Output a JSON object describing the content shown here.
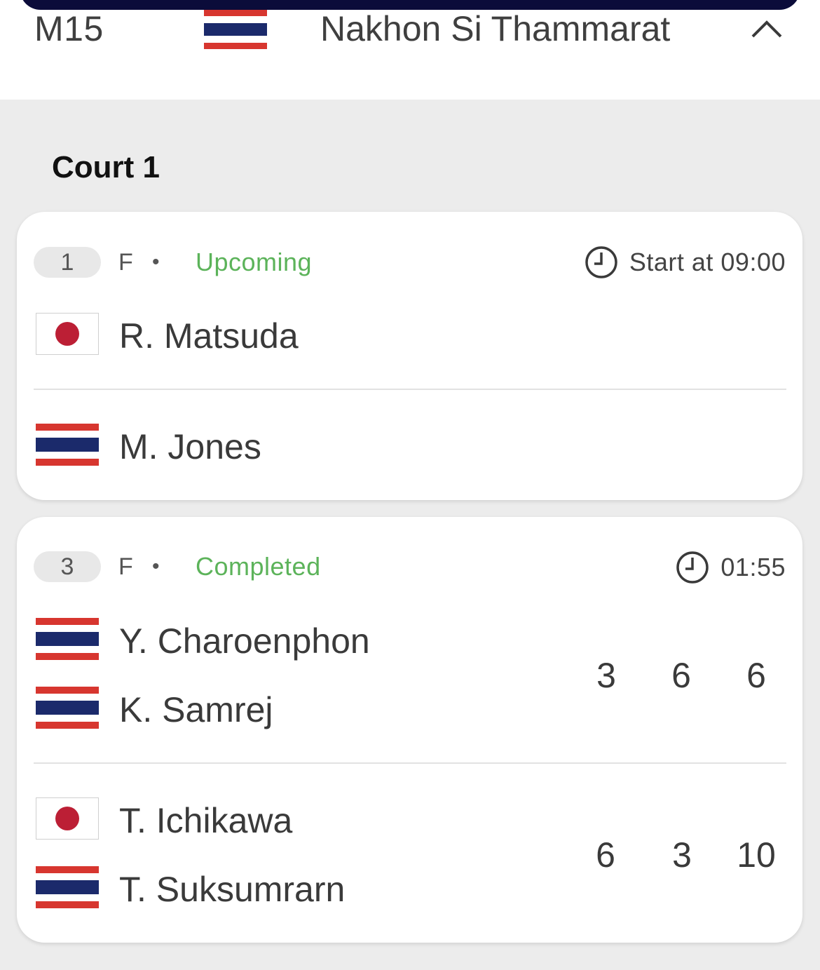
{
  "header": {
    "tour_code": "M15",
    "tour_name": "Nakhon Si Thammarat",
    "country_flag": "thailand-flag",
    "chevron": "chevron-up-icon"
  },
  "court": {
    "title": "Court 1"
  },
  "matches": [
    {
      "number": "1",
      "round": "F",
      "separator": "•",
      "status": "Upcoming",
      "time": "Start at 09:00",
      "players": [
        {
          "name": "R. Matsuda",
          "flag": "japan-flag"
        },
        {
          "name": "M. Jones",
          "flag": "thailand-flag"
        }
      ]
    },
    {
      "number": "3",
      "round": "F",
      "separator": "•",
      "status": "Completed",
      "time": "01:55",
      "teams": [
        {
          "players": [
            {
              "name": "Y. Charoenphon",
              "flag": "thailand-flag"
            },
            {
              "name": "K. Samrej",
              "flag": "thailand-flag"
            }
          ],
          "scores": [
            "3",
            "6",
            "6"
          ]
        },
        {
          "players": [
            {
              "name": "T. Ichikawa",
              "flag": "japan-flag"
            },
            {
              "name": "T. Suksumrarn",
              "flag": "thailand-flag"
            }
          ],
          "scores": [
            "6",
            "3",
            "10"
          ]
        }
      ]
    }
  ],
  "colors": {
    "status_green": "#5cb35a",
    "thai_red": "#d7362f",
    "thai_blue": "#1b2a6b",
    "japan_red": "#bc1f35",
    "header_navy": "#0b0c3a"
  }
}
